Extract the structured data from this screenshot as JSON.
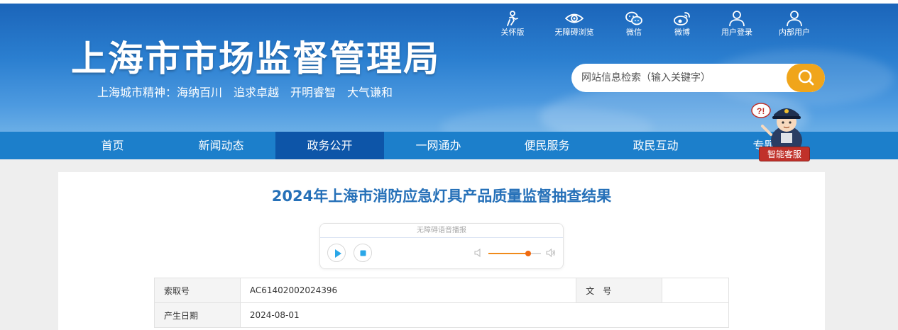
{
  "header": {
    "site_title": "上海市市场监督管理局",
    "slogan": "上海城市精神：海纳百川　追求卓越　开明睿智　大气谦和"
  },
  "tools": [
    {
      "label": "关怀版",
      "icon": "care-mode-icon"
    },
    {
      "label": "无障碍浏览",
      "icon": "eye-icon"
    },
    {
      "label": "微信",
      "icon": "wechat-icon"
    },
    {
      "label": "微博",
      "icon": "weibo-icon"
    },
    {
      "label": "用户登录",
      "icon": "user-icon"
    },
    {
      "label": "内部用户",
      "icon": "internal-user-icon"
    }
  ],
  "search": {
    "placeholder": "网站信息检索（输入关键字）",
    "icon": "search-icon",
    "button_color": "#f0a51b"
  },
  "nav": {
    "items": [
      "首页",
      "新闻动态",
      "政务公开",
      "一网通办",
      "便民服务",
      "政民互动",
      "专题"
    ],
    "active_index": 2
  },
  "assistant": {
    "label": "智能客服",
    "icon": "customer-service-robot-icon"
  },
  "article": {
    "title": "2024年上海市消防应急灯具产品质量监督抽查结果"
  },
  "player": {
    "title": "无障碍语音播报",
    "play_icon": "play-icon",
    "stop_icon": "stop-icon",
    "volume_level": 0.75
  },
  "info": {
    "rows": [
      {
        "label": "索取号",
        "value": "AC61402002024396",
        "label2": "文　号",
        "value2": ""
      },
      {
        "label": "产生日期",
        "value": "2024-08-01"
      }
    ]
  },
  "colors": {
    "header_blue": "#1a63b8",
    "nav_blue": "#1c7fcb",
    "nav_active": "#0d55a8",
    "title_blue": "#2570b8",
    "accent_orange": "#f0a51b"
  }
}
